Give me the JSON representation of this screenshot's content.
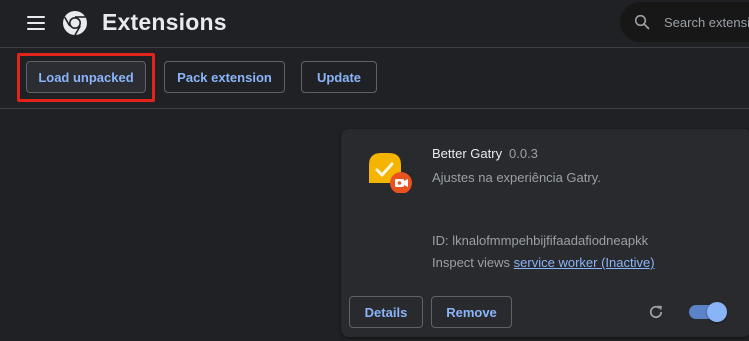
{
  "header": {
    "title": "Extensions",
    "search_placeholder": "Search extensions",
    "icons": [
      "menu-icon",
      "chrome-logo-icon",
      "search-icon"
    ]
  },
  "toolbar": {
    "load_unpacked_label": "Load unpacked",
    "pack_extension_label": "Pack extension",
    "update_label": "Update"
  },
  "extension": {
    "name": "Better Gatry",
    "version": "0.0.3",
    "description": "Ajustes na experiência Gatry.",
    "id_text": "ID: lknalofmmpehbijfifaadafiodneapkk",
    "inspect_label": "Inspect views",
    "inspect_link": "service worker (Inactive)",
    "details_label": "Details",
    "remove_label": "Remove",
    "enabled": true
  },
  "colors": {
    "background": "#202124",
    "card": "#292a2d",
    "accent": "#8ab4f8",
    "highlight": "#e2231a"
  }
}
